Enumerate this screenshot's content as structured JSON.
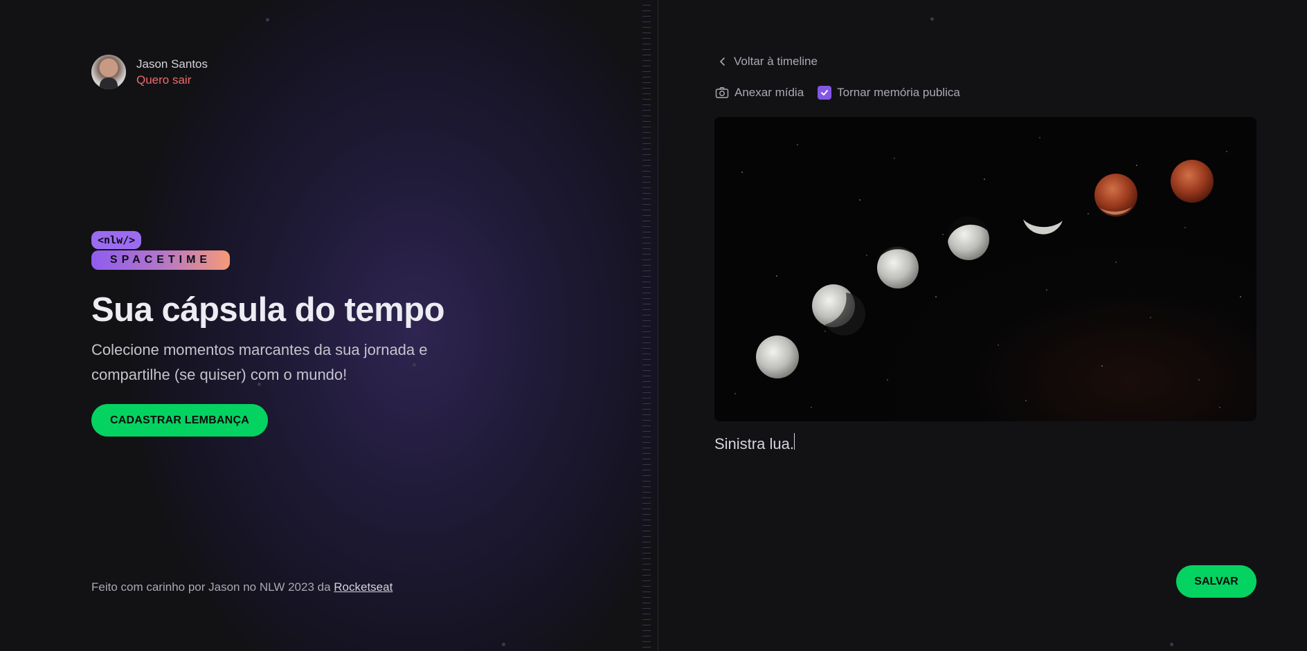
{
  "user": {
    "name": "Jason Santos",
    "logout_label": "Quero sair"
  },
  "logo": {
    "top_text": "<nlw/>",
    "bottom_text": "SPACETIME"
  },
  "hero": {
    "title": "Sua cápsula do tempo",
    "subtitle": "Colecione momentos marcantes da sua jornada e compartilhe (se quiser) com o mundo!",
    "cta_label": "CADASTRAR LEMBANÇA"
  },
  "footer": {
    "text": "Feito com carinho por Jason no NLW 2023 da ",
    "link_label": "Rocketseat"
  },
  "editor": {
    "back_label": "Voltar à timeline",
    "attach_label": "Anexar mídia",
    "public_label": "Tornar memória publica",
    "public_checked": true,
    "caption_value": "Sinistra lua.",
    "save_label": "SALVAR"
  },
  "colors": {
    "accent_green": "#04d361",
    "accent_purple": "#8257e5",
    "logout_red": "#ef6b6b",
    "background": "#121215"
  },
  "icons": {
    "back": "chevron-left-icon",
    "attach": "camera-icon",
    "checkbox": "check-icon"
  }
}
